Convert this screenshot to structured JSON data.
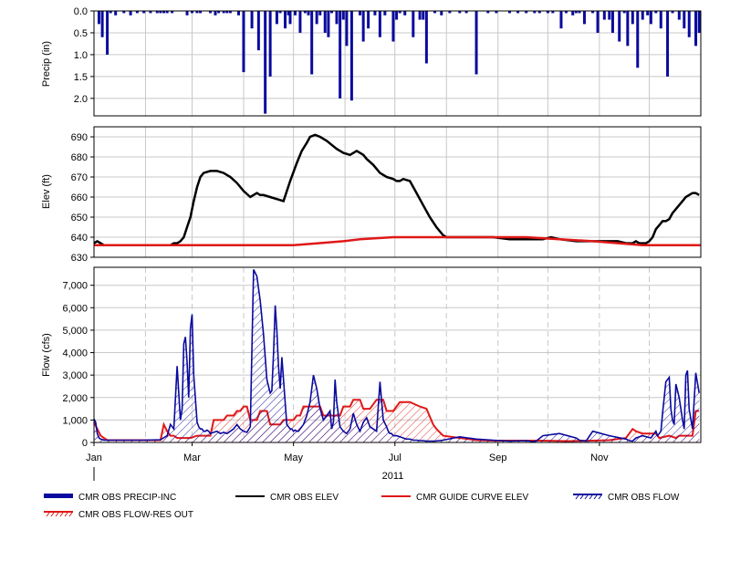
{
  "colors": {
    "precip": "#0a0a9e",
    "elev": "#000000",
    "guide": "#e01818",
    "flow": "#0a0a9e",
    "res_out": "#e01818",
    "grid": "#c8c8c8",
    "frame": "#000000"
  },
  "legend": [
    {
      "name": "CMR OBS PRECIP-INC",
      "style": "thick-bar",
      "color": "#0a0a9e"
    },
    {
      "name": "CMR OBS ELEV",
      "style": "line",
      "color": "#000000"
    },
    {
      "name": "CMR GUIDE CURVE ELEV",
      "style": "line",
      "color": "#e01818"
    },
    {
      "name": "CMR OBS FLOW",
      "style": "hatched-line",
      "color": "#0a0a9e"
    },
    {
      "name": "CMR OBS FLOW-RES OUT",
      "style": "hatched-line",
      "color": "#e01818"
    }
  ],
  "chart_data": [
    {
      "type": "bar",
      "ylabel": "Precip (in)",
      "y_inverted": true,
      "ylim": [
        0,
        2.4
      ],
      "yticks": [
        "0.0",
        "0.5",
        "1.0",
        "1.5",
        "2.0"
      ],
      "ytick_values": [
        0,
        0.5,
        1.0,
        1.5,
        2.0
      ],
      "grid": true,
      "series": [
        {
          "name": "CMR OBS PRECIP-INC",
          "x_day_of_year": [
            3,
            5,
            8,
            10,
            13,
            18,
            22,
            26,
            30,
            34,
            38,
            40,
            42,
            44,
            47,
            56,
            59,
            62,
            64,
            70,
            73,
            75,
            78,
            80,
            82,
            87,
            90,
            95,
            99,
            103,
            106,
            110,
            112,
            115,
            117,
            118,
            121,
            124,
            127,
            129,
            131,
            134,
            136,
            139,
            141,
            143,
            146,
            148,
            150,
            152,
            155,
            160,
            162,
            165,
            169,
            172,
            175,
            180,
            182,
            184,
            187,
            192,
            196,
            198,
            200,
            205,
            209,
            214,
            220,
            224,
            230,
            237,
            242,
            250,
            255,
            260,
            265,
            268,
            273,
            276,
            281,
            284,
            288,
            290,
            292,
            295,
            300,
            303,
            307,
            310,
            312,
            316,
            319,
            321,
            324,
            327,
            330,
            333,
            335,
            338,
            341,
            345,
            348,
            352,
            355,
            358,
            362,
            364
          ],
          "values": [
            0.3,
            0.6,
            1.0,
            0.05,
            0.1,
            0.05,
            0.1,
            0.05,
            0.05,
            0.05,
            0.05,
            0.05,
            0.05,
            0.05,
            0.05,
            0.1,
            0.05,
            0.05,
            0.05,
            0.05,
            0.1,
            0.05,
            0.05,
            0.05,
            0.05,
            0.1,
            1.4,
            0.4,
            0.9,
            2.35,
            1.5,
            0.3,
            0.05,
            0.4,
            0.1,
            0.3,
            0.1,
            0.5,
            0.05,
            0.1,
            1.45,
            0.3,
            0.1,
            0.5,
            0.6,
            0.05,
            0.3,
            2.0,
            0.2,
            0.8,
            2.05,
            0.1,
            0.7,
            0.4,
            0.1,
            0.6,
            0.1,
            0.7,
            0.2,
            0.05,
            0.1,
            0.6,
            0.2,
            0.2,
            1.2,
            0.05,
            0.1,
            0.05,
            0.05,
            0.05,
            1.45,
            0.05,
            0.05,
            0.05,
            0.05,
            0.05,
            0.05,
            0.05,
            0.05,
            0.05,
            0.4,
            0.05,
            0.1,
            0.05,
            0.05,
            0.3,
            0.05,
            0.5,
            0.2,
            0.2,
            0.5,
            0.7,
            0.05,
            0.8,
            0.3,
            1.3,
            0.2,
            0.1,
            0.3,
            0.05,
            0.4,
            1.5,
            0.05,
            0.2,
            0.4,
            0.6,
            0.8,
            0.5,
            0.1,
            1.2,
            0.1,
            0.4,
            0.1,
            1.5,
            0.3,
            0.5,
            1.2,
            0.2,
            0.4
          ]
        }
      ]
    },
    {
      "type": "line",
      "ylabel": "Elev (ft)",
      "ylim": [
        630,
        695
      ],
      "yticks": [
        "630",
        "640",
        "650",
        "660",
        "670",
        "680",
        "690"
      ],
      "ytick_values": [
        630,
        640,
        650,
        660,
        670,
        680,
        690
      ],
      "grid": true,
      "series": [
        {
          "name": "CMR OBS ELEV",
          "x_day_of_year": [
            0,
            2,
            4,
            6,
            10,
            20,
            30,
            40,
            46,
            48,
            50,
            52,
            54,
            56,
            58,
            60,
            62,
            64,
            66,
            70,
            74,
            78,
            82,
            86,
            90,
            94,
            98,
            100,
            102,
            106,
            110,
            114,
            118,
            122,
            125,
            128,
            130,
            133,
            136,
            138,
            140,
            143,
            146,
            150,
            154,
            158,
            160,
            162,
            164,
            168,
            172,
            176,
            180,
            182,
            184,
            186,
            190,
            194,
            198,
            202,
            206,
            210,
            212,
            215,
            220,
            230,
            240,
            250,
            260,
            270,
            275,
            280,
            290,
            300,
            310,
            315,
            320,
            324,
            326,
            328,
            330,
            332,
            334,
            336,
            338,
            340,
            342,
            344,
            346,
            348,
            350,
            352,
            354,
            356,
            358,
            360,
            362,
            364
          ],
          "values": [
            637,
            638,
            637,
            636,
            636,
            636,
            636,
            636,
            636,
            637,
            637,
            638,
            640,
            645,
            650,
            658,
            665,
            670,
            672,
            673,
            673,
            672,
            670,
            667,
            663,
            660,
            662,
            661,
            661,
            660,
            659,
            658,
            668,
            677,
            683,
            687,
            690,
            691,
            690,
            689,
            688,
            686,
            684,
            682,
            681,
            683,
            682,
            681,
            679,
            676,
            672,
            670,
            669,
            668,
            668,
            669,
            668,
            662,
            656,
            650,
            645,
            641,
            640,
            640,
            640,
            640,
            640,
            639,
            639,
            639,
            640,
            639,
            638,
            638,
            638,
            638,
            637,
            637,
            638,
            637,
            637,
            637,
            638,
            640,
            644,
            646,
            648,
            648,
            649,
            652,
            654,
            656,
            658,
            660,
            661,
            662,
            662,
            661
          ]
        },
        {
          "name": "CMR GUIDE CURVE ELEV",
          "x_day_of_year": [
            0,
            120,
            135,
            150,
            160,
            180,
            200,
            240,
            260,
            280,
            300,
            330,
            365
          ],
          "values": [
            636,
            636,
            637,
            638,
            639,
            640,
            640,
            640,
            640,
            639,
            638,
            636,
            636
          ]
        }
      ]
    },
    {
      "type": "area",
      "ylabel": "Flow (cfs)",
      "xlabel": "2011",
      "ylim": [
        0,
        7800
      ],
      "yticks": [
        "0",
        "1,000",
        "2,000",
        "3,000",
        "4,000",
        "5,000",
        "6,000",
        "7,000"
      ],
      "ytick_values": [
        0,
        1000,
        2000,
        3000,
        4000,
        5000,
        6000,
        7000
      ],
      "xticks": [
        "Jan",
        "Mar",
        "May",
        "Jul",
        "Sep",
        "Nov"
      ],
      "xtick_days": [
        0,
        59,
        120,
        181,
        243,
        304
      ],
      "grid": true,
      "series": [
        {
          "name": "CMR OBS FLOW",
          "x_day_of_year": [
            0,
            1,
            2,
            3,
            4,
            6,
            10,
            20,
            30,
            40,
            44,
            46,
            48,
            50,
            51,
            52,
            53,
            54,
            55,
            56,
            57,
            58,
            59,
            60,
            62,
            63,
            64,
            65,
            66,
            67,
            68,
            69,
            70,
            72,
            74,
            76,
            78,
            80,
            82,
            84,
            86,
            88,
            90,
            92,
            94,
            96,
            98,
            100,
            102,
            104,
            106,
            107,
            108,
            109,
            110,
            111,
            112,
            113,
            114,
            115,
            116,
            117,
            118,
            119,
            120,
            121,
            122,
            123,
            124,
            126,
            128,
            130,
            132,
            134,
            136,
            138,
            140,
            142,
            143,
            144,
            145,
            146,
            148,
            150,
            152,
            154,
            156,
            158,
            160,
            162,
            164,
            166,
            168,
            170,
            172,
            174,
            176,
            177,
            178,
            179,
            180,
            182,
            184,
            186,
            188,
            190,
            192,
            194,
            196,
            198,
            200,
            205,
            210,
            220,
            230,
            240,
            250,
            260,
            262,
            264,
            266,
            270,
            280,
            290,
            292,
            294,
            296,
            300,
            310,
            320,
            322,
            324,
            326,
            330,
            335,
            338,
            339,
            340,
            341,
            342,
            344,
            346,
            347,
            348,
            349,
            350,
            352,
            354,
            355,
            356,
            357,
            358,
            360,
            362,
            364
          ],
          "values": [
            1050,
            900,
            400,
            200,
            150,
            100,
            100,
            100,
            100,
            120,
            300,
            800,
            600,
            3400,
            2200,
            1000,
            1500,
            4400,
            4700,
            3600,
            2000,
            5100,
            5700,
            3000,
            900,
            700,
            600,
            600,
            500,
            500,
            550,
            500,
            400,
            450,
            500,
            400,
            450,
            400,
            500,
            600,
            800,
            600,
            500,
            450,
            700,
            7700,
            7400,
            6300,
            4800,
            2800,
            2200,
            2300,
            4000,
            6100,
            5000,
            3400,
            2400,
            3800,
            2800,
            1800,
            800,
            700,
            600,
            600,
            500,
            550,
            500,
            500,
            600,
            800,
            1200,
            1800,
            3000,
            2400,
            1500,
            1000,
            1200,
            1400,
            600,
            900,
            2800,
            1800,
            700,
            500,
            400,
            600,
            1300,
            800,
            500,
            900,
            1100,
            700,
            600,
            500,
            2700,
            1000,
            700,
            500,
            400,
            400,
            300,
            300,
            250,
            200,
            150,
            150,
            100,
            100,
            80,
            80,
            60,
            60,
            100,
            250,
            150,
            100,
            60,
            80,
            60,
            40,
            60,
            300,
            400,
            200,
            100,
            80,
            60,
            500,
            300,
            150,
            80,
            60,
            200,
            300,
            200,
            500,
            300,
            400,
            500,
            1300,
            2700,
            2900,
            1500,
            1000,
            800,
            2600,
            2000,
            1000,
            600,
            3000,
            3200,
            1500,
            600,
            3100,
            2200,
            3100,
            1200,
            900,
            800,
            900,
            1000
          ]
        },
        {
          "name": "CMR OBS FLOW-RES OUT",
          "x_day_of_year": [
            0,
            2,
            4,
            6,
            8,
            20,
            40,
            42,
            44,
            46,
            48,
            50,
            56,
            58,
            62,
            70,
            72,
            78,
            80,
            84,
            86,
            88,
            90,
            92,
            94,
            98,
            100,
            104,
            106,
            112,
            114,
            120,
            122,
            124,
            126,
            136,
            138,
            148,
            150,
            154,
            156,
            160,
            162,
            166,
            170,
            174,
            176,
            180,
            184,
            190,
            196,
            200,
            204,
            206,
            210,
            220,
            230,
            240,
            260,
            270,
            285,
            300,
            310,
            315,
            320,
            324,
            326,
            330,
            338,
            340,
            346,
            350,
            352,
            360,
            362,
            364
          ],
          "values": [
            900,
            600,
            300,
            200,
            100,
            100,
            100,
            800,
            500,
            300,
            300,
            200,
            200,
            200,
            300,
            300,
            1000,
            1000,
            1200,
            1200,
            1400,
            1400,
            1600,
            1600,
            1000,
            1000,
            1400,
            1400,
            800,
            800,
            1000,
            1000,
            1200,
            1200,
            1600,
            1600,
            1200,
            1200,
            1600,
            1600,
            1900,
            1900,
            1500,
            1500,
            1900,
            1900,
            1400,
            1400,
            1800,
            1800,
            1600,
            1500,
            800,
            600,
            300,
            200,
            100,
            80,
            80,
            80,
            60,
            80,
            100,
            150,
            200,
            600,
            500,
            400,
            400,
            200,
            300,
            200,
            300,
            300,
            1400,
            1400
          ]
        }
      ]
    }
  ]
}
